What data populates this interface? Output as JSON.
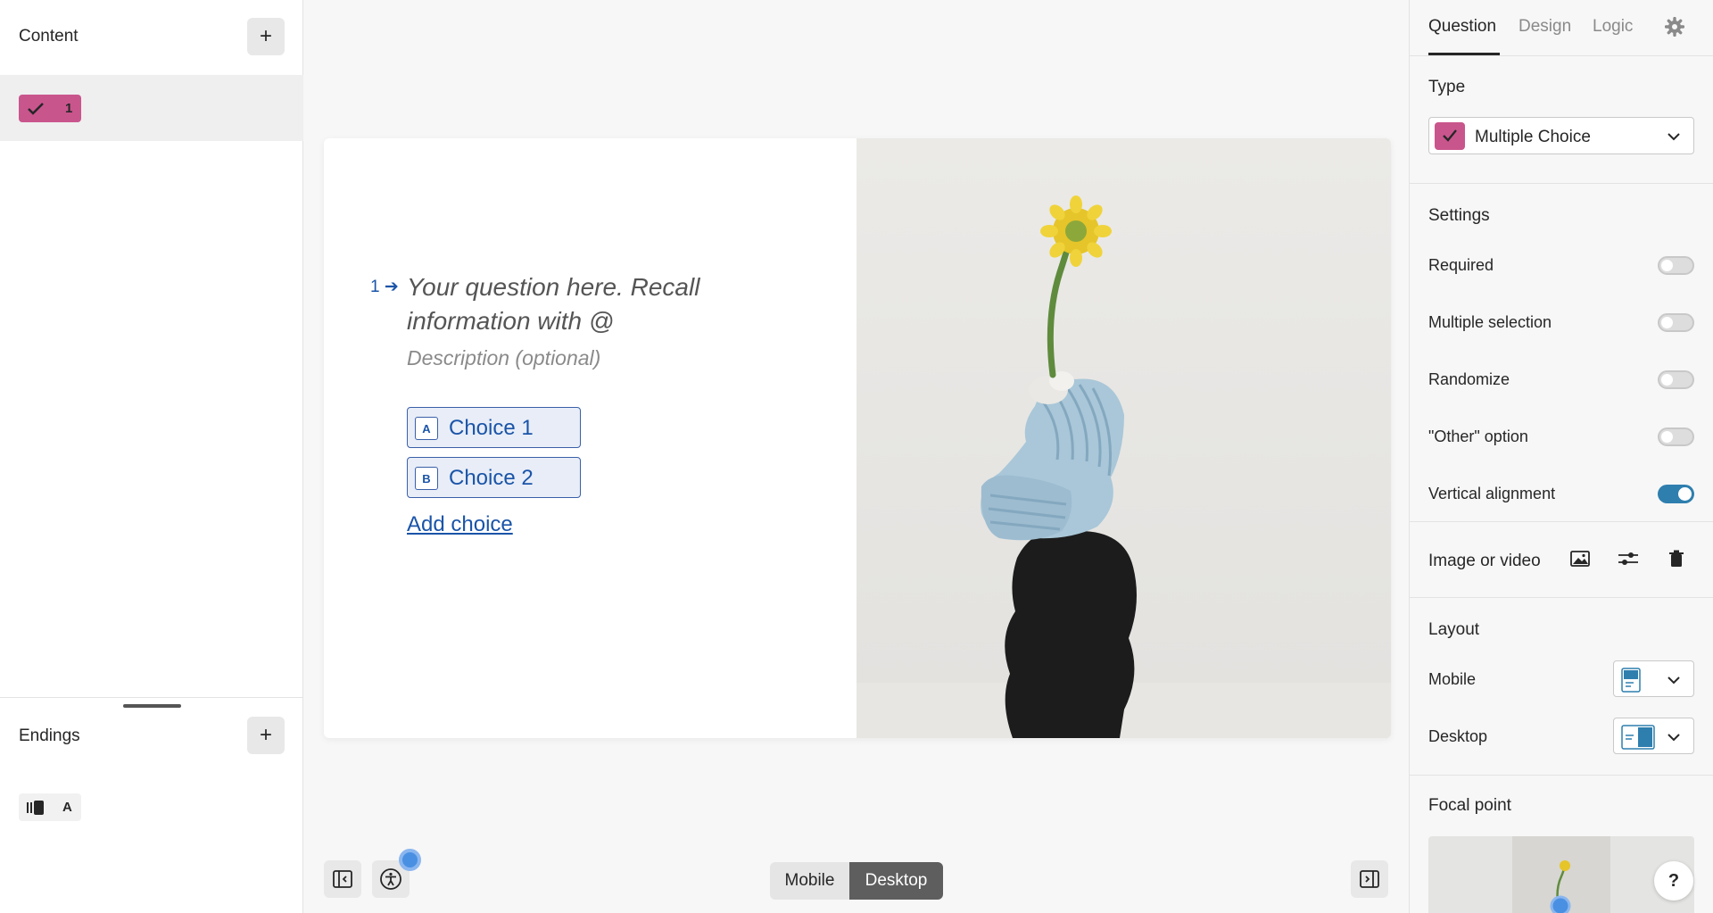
{
  "content_panel": {
    "title": "Content",
    "add_label": "+",
    "question_number": "1",
    "question_color": "#c9558d"
  },
  "endings_panel": {
    "title": "Endings",
    "add_label": "+",
    "ending_label": "A"
  },
  "question": {
    "number": "1",
    "text": "Your question here. Recall information with @",
    "description": "Description (optional)",
    "choices": [
      {
        "key": "A",
        "label": "Choice 1"
      },
      {
        "key": "B",
        "label": "Choice 2"
      }
    ],
    "add_choice": "Add choice"
  },
  "preview_toggle": {
    "mobile": "Mobile",
    "desktop": "Desktop",
    "selected": "Desktop"
  },
  "right_panel": {
    "tabs": [
      "Question",
      "Design",
      "Logic"
    ],
    "active_tab": "Question",
    "type_section": {
      "title": "Type",
      "value": "Multiple Choice"
    },
    "settings_section": {
      "title": "Settings",
      "items": [
        {
          "label": "Required",
          "on": false
        },
        {
          "label": "Multiple selection",
          "on": false
        },
        {
          "label": "Randomize",
          "on": false
        },
        {
          "label": "\"Other\" option",
          "on": false
        },
        {
          "label": "Vertical alignment",
          "on": true
        }
      ]
    },
    "media_section": {
      "title": "Image or video"
    },
    "layout_section": {
      "title": "Layout",
      "mobile_label": "Mobile",
      "desktop_label": "Desktop"
    },
    "focal_section": {
      "title": "Focal point"
    }
  },
  "help_label": "?",
  "colors": {
    "accent_blue": "#1a54a8",
    "toggle_on": "#2e7fae",
    "question_pink": "#c9558d"
  }
}
